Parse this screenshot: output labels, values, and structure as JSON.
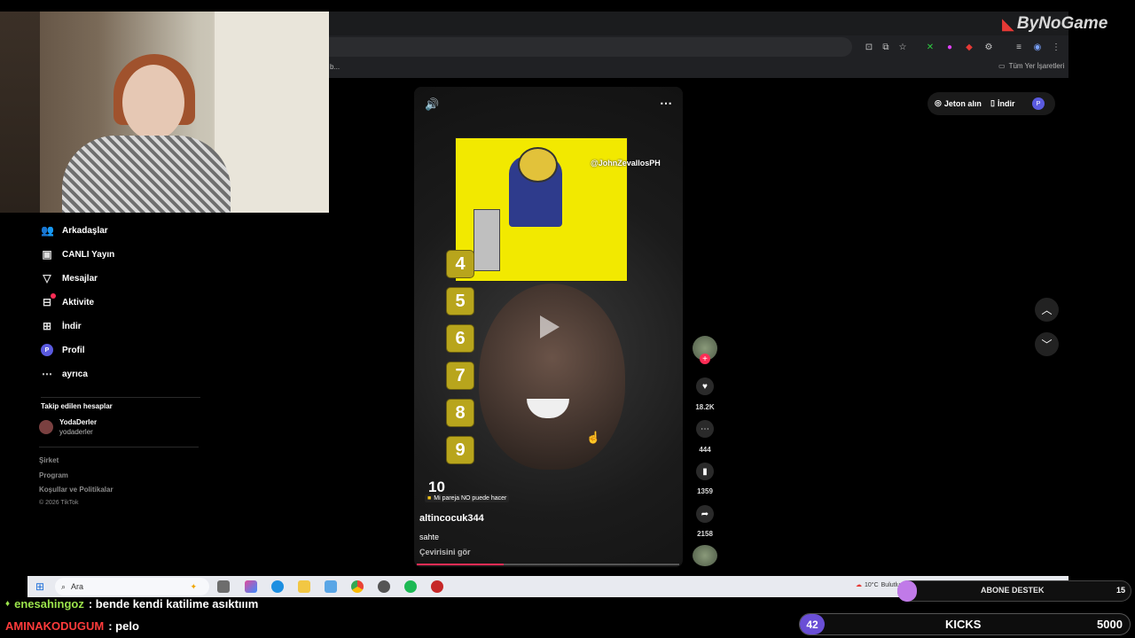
{
  "overlay": {
    "logo_text": "ByNoGame"
  },
  "browser": {
    "bookmark_partial": "b...",
    "all_bookmarks": "Tüm Yer İşaretleri"
  },
  "header": {
    "coins_label": "Jeton alın",
    "download_label": "İndir",
    "profile_initial": "P"
  },
  "sidebar": {
    "items": [
      {
        "label": "Arkadaşlar",
        "icon": "friends-icon"
      },
      {
        "label": "CANLI Yayın",
        "icon": "live-icon"
      },
      {
        "label": "Mesajlar",
        "icon": "messages-icon"
      },
      {
        "label": "Aktivite",
        "icon": "activity-icon"
      },
      {
        "label": "İndir",
        "icon": "download-icon"
      },
      {
        "label": "Profil",
        "icon": "profile-icon"
      },
      {
        "label": "ayrıca",
        "icon": "more-icon"
      }
    ],
    "profile_initial": "P",
    "following_title": "Takip edilen hesaplar",
    "followed": {
      "name": "YodaDerler",
      "handle": "yodaderler"
    },
    "footer": [
      "Şirket",
      "Program",
      "Koşullar ve Politikalar",
      "© 2026 TikTok"
    ]
  },
  "video": {
    "watermark": "@JohnZevallosPH",
    "numbers": [
      "4",
      "5",
      "6",
      "7",
      "8",
      "9",
      "10"
    ],
    "effect_label": "Mi pareja NO puede hacer",
    "author": "altincocuk344",
    "caption": "sahte",
    "translate_label": "Çevirisini gör",
    "progress": 0.33
  },
  "actions": {
    "likes": "18.2K",
    "comments": "444",
    "saves": "1359",
    "shares": "2158"
  },
  "taskbar": {
    "search_placeholder": "Ara",
    "temperature": "10°C",
    "weather": "Bulutlu"
  },
  "chat": [
    {
      "user": "enesahingoz",
      "message": ": bende kendi katilime asıktııım",
      "color": "#9be34b"
    },
    {
      "user": "AMINAKODUGUM",
      "message": ": pelo",
      "color": "#ff3b3b"
    }
  ],
  "widgets": {
    "abone_label": "ABONE DESTEK",
    "abone_count": "15",
    "kicks_count": "42",
    "kicks_label": "KICKS",
    "kicks_goal": "5000"
  }
}
